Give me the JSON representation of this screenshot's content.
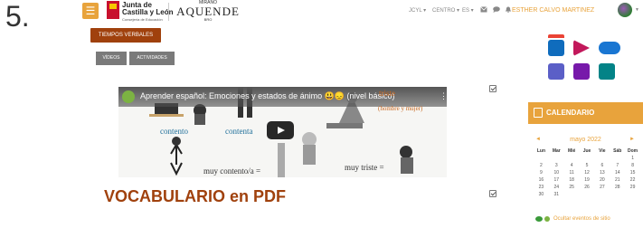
{
  "step_label": "5.",
  "header": {
    "menu_icon": "hamburger-icon",
    "jcyl_logo": {
      "line1": "Junta de",
      "line2": "Castilla y León",
      "line3": "Consejería de Educación"
    },
    "aquende_logo": {
      "top": "MIRANO",
      "name": "AQUENDE",
      "bottom": "BRO"
    },
    "nav": [
      {
        "label": "JCYL ▾"
      },
      {
        "label": "CENTRO ▾"
      },
      {
        "label": "ES ▾"
      }
    ],
    "icons": [
      "mail-icon",
      "chat-icon",
      "bell-icon"
    ],
    "user_name": "ESTHER CALVO MARTINEZ",
    "accent_color": "#e8a33c"
  },
  "main": {
    "section_button": "TIEMPOS VERBALES",
    "tabs": [
      {
        "label": "VÍDEOS"
      },
      {
        "label": "ACTIVIDADES"
      }
    ],
    "video": {
      "title": "Aprender español: Emociones y estados de ánimo 😃😞 (nivel básico)",
      "labels": {
        "contento_1": "contento",
        "contento_2": "contenta",
        "triste": "triste",
        "hombre_mujer": "(hombre y mujer)",
        "muy_contento": "muy contento/a =",
        "muy_triste": "muy triste ="
      },
      "play_icon": "play-icon"
    },
    "heading": "VOCABULARIO en PDF",
    "heading_color": "#a0410d"
  },
  "sidebar": {
    "apps": [
      "outlook-icon",
      "power-automate-icon",
      "onedrive-icon",
      "teams-icon",
      "onenote-icon",
      "sharepoint-icon"
    ],
    "calendar": {
      "title": "CALENDARIO",
      "month": "mayo 2022",
      "prev": "◄",
      "next": "►",
      "weekdays": [
        "Lun",
        "Mar",
        "Mié",
        "Jue",
        "Vie",
        "Sáb",
        "Dom"
      ],
      "weeks": [
        [
          "",
          "",
          "",
          "",
          "",
          "",
          "1"
        ],
        [
          "2",
          "3",
          "4",
          "5",
          "6",
          "7",
          "8"
        ],
        [
          "9",
          "10",
          "11",
          "12",
          "13",
          "14",
          "15"
        ],
        [
          "16",
          "17",
          "18",
          "19",
          "20",
          "21",
          "22"
        ],
        [
          "23",
          "24",
          "25",
          "26",
          "27",
          "28",
          "29"
        ],
        [
          "30",
          "31",
          "",
          "",
          "",
          "",
          ""
        ]
      ],
      "footer_link": "Ocultar eventos de sitio"
    }
  }
}
